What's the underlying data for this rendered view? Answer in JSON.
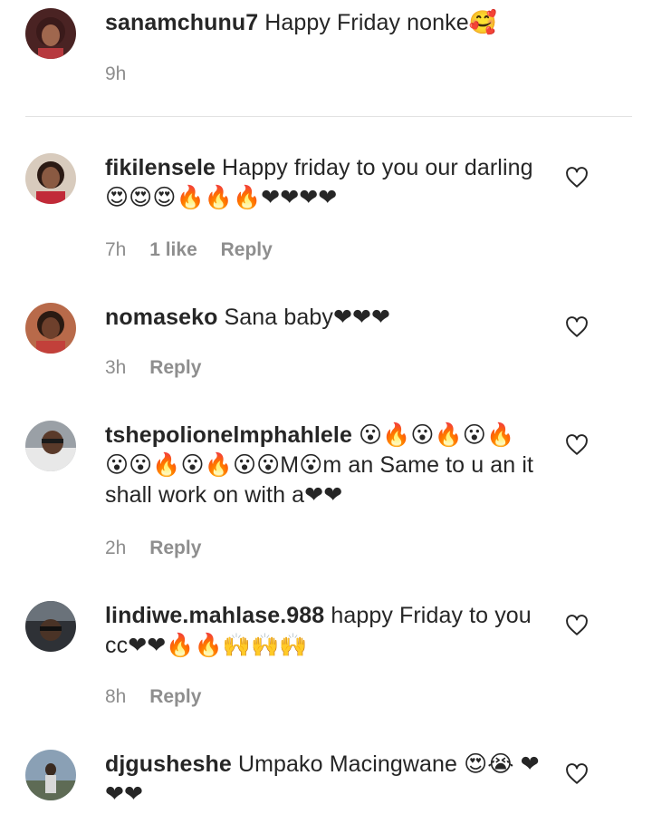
{
  "comments": [
    {
      "username": "sanamchunu7",
      "text": "Happy Friday nonke🥰",
      "time": "9h",
      "likes": "",
      "reply": "",
      "avatar_icon": "profile-photo",
      "avatar_bg": "#5a2a2a"
    },
    {
      "username": "fikilensele",
      "text": "Happy friday to you our darling 😍😍😍🔥🔥🔥❤❤❤❤",
      "time": "7h",
      "likes": "1 like",
      "reply": "Reply",
      "avatar_icon": "profile-photo",
      "avatar_bg": "#c9b8a6"
    },
    {
      "username": "nomaseko",
      "text": "Sana baby❤❤❤",
      "time": "3h",
      "likes": "",
      "reply": "Reply",
      "avatar_icon": "profile-photo",
      "avatar_bg": "#7a4535"
    },
    {
      "username": "tshepolionelmphahlele",
      "text": "😮🔥😮🔥😮🔥 😮😮🔥😮🔥😮😮M😮m an Same to u an it shall work on with a❤❤",
      "time": "2h",
      "likes": "",
      "reply": "Reply",
      "avatar_icon": "profile-photo",
      "avatar_bg": "#8a8f96"
    },
    {
      "username": "lindiwe.mahlase.988",
      "text": "happy Friday to you cc❤❤🔥🔥🙌🙌🙌",
      "time": "8h",
      "likes": "",
      "reply": "Reply",
      "avatar_icon": "profile-photo",
      "avatar_bg": "#3c3f44"
    },
    {
      "username": "djgusheshe",
      "text": "Umpako Macingwane 😍😭 ❤❤❤",
      "time": "",
      "likes": "",
      "reply": "",
      "avatar_icon": "profile-photo",
      "avatar_bg": "#6f7a86"
    }
  ],
  "like_icon": "heart-outline-icon",
  "colors": {
    "text": "#262626",
    "meta": "#8e8e8e",
    "divider": "#e2e2e2",
    "heart_stroke": "#262626"
  }
}
